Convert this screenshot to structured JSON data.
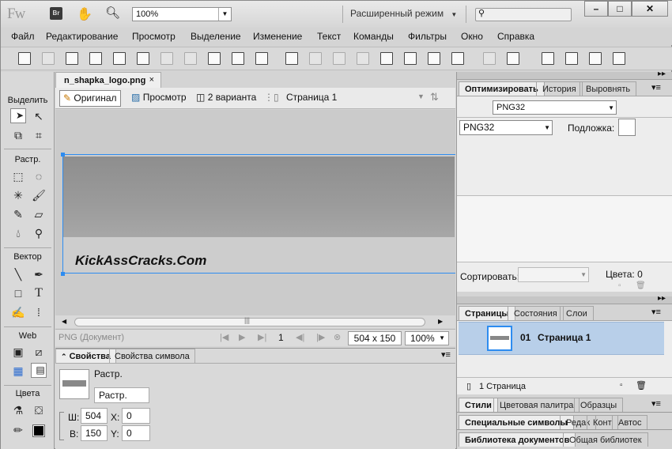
{
  "titlebar": {
    "app_logo": "Fw",
    "bridge_logo": "Br",
    "zoom_value": "100%",
    "workspace_mode": "Расширенный режим",
    "window_buttons": [
      "–",
      "□",
      "✕"
    ]
  },
  "menu": [
    "Файл",
    "Редактирование",
    "Просмотр",
    "Выделение",
    "Изменение",
    "Текст",
    "Команды",
    "Фильтры",
    "Окно",
    "Справка"
  ],
  "tools": {
    "sections": [
      "Выделить",
      "Растр.",
      "Вектор",
      "Web",
      "Цвета"
    ]
  },
  "document": {
    "tab_title": "n_shapka_logo.png",
    "tab_close": "×",
    "views": [
      "Оригинал",
      "Просмотр",
      "2 варианта",
      "Страница 1"
    ],
    "canvas_text": "KickAssCracks.Com",
    "status_type": "PNG (Документ)",
    "page_number": "1",
    "dimensions": "504 x 150",
    "zoom": "100%"
  },
  "properties": {
    "tabs": [
      "Свойства",
      "Свойства символа"
    ],
    "object_type": "Растр.",
    "object_name": "Растр.",
    "w_label": "Ш:",
    "w_value": "504",
    "h_label": "В:",
    "h_value": "150",
    "x_label": "X:",
    "x_value": "0",
    "y_label": "Y:",
    "y_value": "0"
  },
  "optimize": {
    "tabs": [
      "Оптимизировать",
      "История",
      "Выровнять"
    ],
    "preset": "PNG32",
    "format": "PNG32",
    "matte_label": "Подложка:",
    "sort_label": "Сортировать:",
    "colors_label": "Цвета: 0"
  },
  "pages": {
    "tabs": [
      "Страницы",
      "Состояния",
      "Слои"
    ],
    "page_number": "01",
    "page_name": "Страница 1",
    "footer": "1 Страница"
  },
  "bottom_panels": {
    "row1": [
      "Стили",
      "Цветовая палитра",
      "Образцы"
    ],
    "row2": [
      "Специальные символы",
      "Редак",
      "Конт",
      "Автос"
    ],
    "row3": [
      "Библиотека документов",
      "Общая библиотек"
    ]
  },
  "colors": {
    "selection": "#2d8cf0",
    "page_highlight": "#b8cfe9"
  }
}
